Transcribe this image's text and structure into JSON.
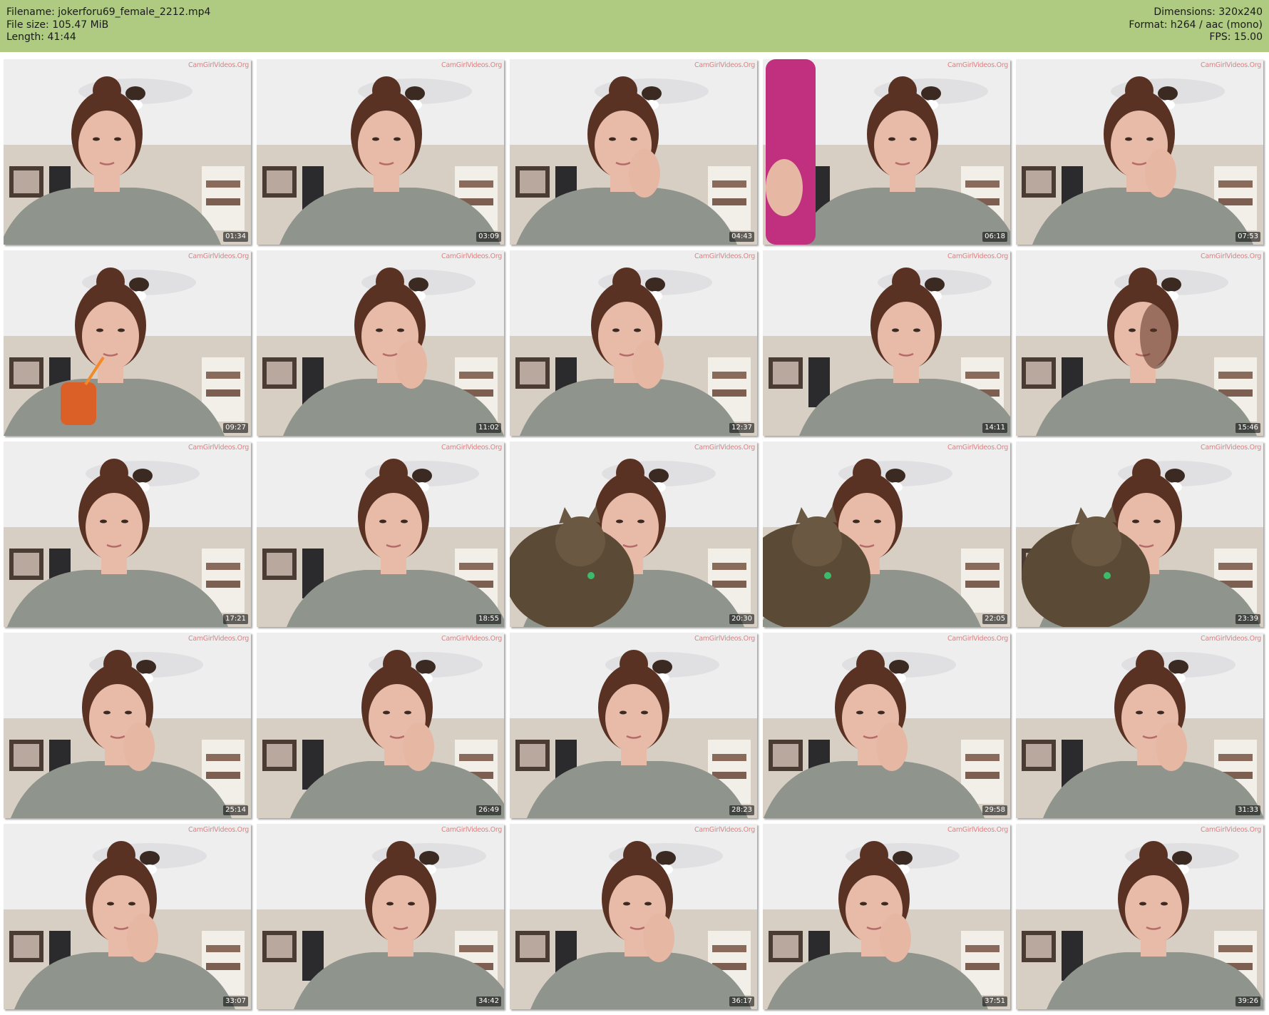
{
  "header": {
    "filename_label": "Filename: jokerforu69_female_2212.mp4",
    "filesize_label": "File size: 105.47 MiB",
    "length_label": "Length: 41:44",
    "dimensions_label": "Dimensions: 320x240",
    "format_label": "Format: h264 / aac (mono)",
    "fps_label": "FPS: 15.00"
  },
  "watermark": "CamGirlVideos.Org",
  "thumbnails": [
    {
      "time": "01:34",
      "variant": "plain"
    },
    {
      "time": "03:09",
      "variant": "plain"
    },
    {
      "time": "04:43",
      "variant": "hand"
    },
    {
      "time": "06:18",
      "variant": "phone"
    },
    {
      "time": "07:53",
      "variant": "hand"
    },
    {
      "time": "09:27",
      "variant": "cup"
    },
    {
      "time": "11:02",
      "variant": "hand"
    },
    {
      "time": "12:37",
      "variant": "hand"
    },
    {
      "time": "14:11",
      "variant": "plain"
    },
    {
      "time": "15:46",
      "variant": "side"
    },
    {
      "time": "17:21",
      "variant": "plain"
    },
    {
      "time": "18:55",
      "variant": "plain"
    },
    {
      "time": "20:30",
      "variant": "cat"
    },
    {
      "time": "22:05",
      "variant": "cat"
    },
    {
      "time": "23:39",
      "variant": "cat"
    },
    {
      "time": "25:14",
      "variant": "hand"
    },
    {
      "time": "26:49",
      "variant": "hand"
    },
    {
      "time": "28:23",
      "variant": "plain"
    },
    {
      "time": "29:58",
      "variant": "hand"
    },
    {
      "time": "31:33",
      "variant": "hand"
    },
    {
      "time": "33:07",
      "variant": "hand"
    },
    {
      "time": "34:42",
      "variant": "plain"
    },
    {
      "time": "36:17",
      "variant": "hand"
    },
    {
      "time": "37:51",
      "variant": "hand"
    },
    {
      "time": "39:26",
      "variant": "plain"
    }
  ],
  "colors": {
    "header_bg": "#aecb81",
    "wall": "#d8cfc4",
    "ceiling": "#eeeeef",
    "shirt": "#8f948c",
    "skin": "#e8bba8",
    "hair": "#5a3224",
    "cat": "#5b4a36"
  }
}
